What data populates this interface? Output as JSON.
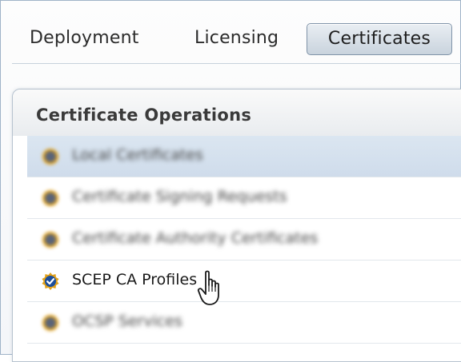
{
  "tabs": [
    {
      "label": "Deployment",
      "selected": false
    },
    {
      "label": "Licensing",
      "selected": false
    },
    {
      "label": "Certificates",
      "selected": true
    }
  ],
  "panel": {
    "title": "Certificate Operations",
    "items": [
      {
        "label": "Local Certificates",
        "blurred": true,
        "highlighted": true,
        "icon": "certificate-icon"
      },
      {
        "label": "Certificate Signing Requests",
        "blurred": true,
        "highlighted": false,
        "icon": "certificate-icon"
      },
      {
        "label": "Certificate Authority Certificates",
        "blurred": true,
        "highlighted": false,
        "icon": "certificate-icon"
      },
      {
        "label": "SCEP CA Profiles",
        "blurred": false,
        "highlighted": false,
        "icon": "certificate-check-icon"
      },
      {
        "label": "OCSP Services",
        "blurred": true,
        "highlighted": false,
        "icon": "certificate-icon"
      }
    ]
  },
  "colors": {
    "selected_tab_bg": "#c9d3dd",
    "highlight_row": "#d4e0ed",
    "icon_gold": "#e3a21a",
    "icon_blue": "#1d4f9c"
  },
  "cursor_icon": "hand-pointer-icon"
}
